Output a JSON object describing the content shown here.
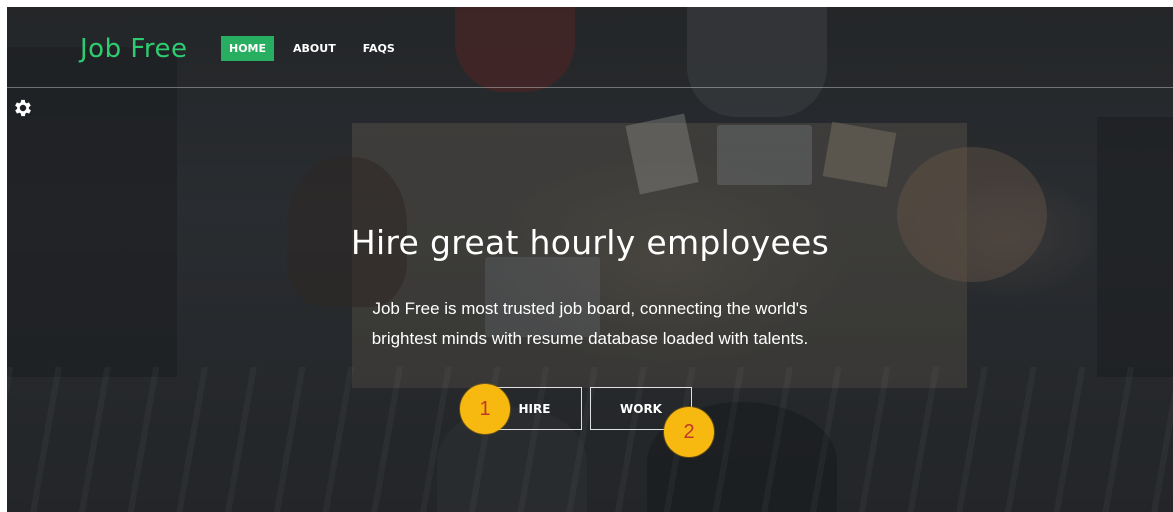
{
  "header": {
    "brand": "Job Free",
    "nav": [
      {
        "label": "HOME",
        "active": true
      },
      {
        "label": "ABOUT",
        "active": false
      },
      {
        "label": "FAQS",
        "active": false
      }
    ],
    "settings_icon": "gear-icon"
  },
  "hero": {
    "title": "Hire great hourly employees",
    "subtitle_line1": "Job Free is most trusted job board, connecting the world's",
    "subtitle_line2": "brightest minds with resume database loaded with talents.",
    "buttons": {
      "hire": "HIRE",
      "work": "WORK"
    }
  },
  "annotations": {
    "marker1": "1",
    "marker2": "2"
  },
  "colors": {
    "brand_green": "#2ecc71",
    "active_nav_bg": "#27ae60",
    "marker_fill": "#f7b90f",
    "marker_text": "#c0392b"
  }
}
